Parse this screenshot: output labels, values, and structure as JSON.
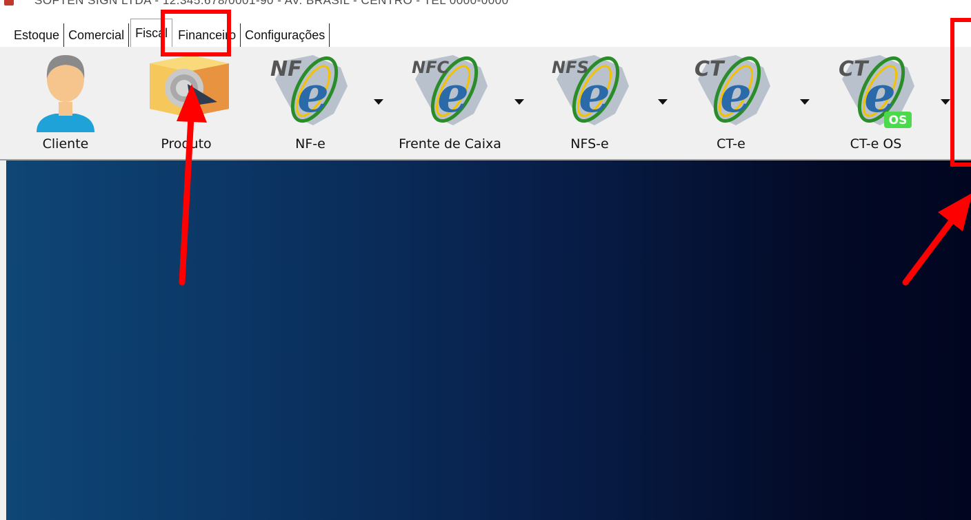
{
  "window": {
    "title": "SOFTEN SIGN LTDA - 12.345.678/0001-90 - AV. BRASIL - CENTRO - TEL 0000-0000"
  },
  "tabs": [
    {
      "label": "Estoque"
    },
    {
      "label": "Comercial"
    },
    {
      "label": "Fiscal",
      "active": true
    },
    {
      "label": "Financeiro"
    },
    {
      "label": "Configurações"
    }
  ],
  "toolbar": {
    "items": [
      {
        "label": "Cliente",
        "icon": "user-icon"
      },
      {
        "label": "Produto",
        "icon": "product-box-icon"
      },
      {
        "label": "NF-e",
        "icon": "nfe-icon",
        "badge": "NF",
        "has_dropdown": true
      },
      {
        "label": "Frente de Caixa",
        "icon": "nfce-icon",
        "badge": "NFC",
        "has_dropdown": true
      },
      {
        "label": "NFS-e",
        "icon": "nfse-icon",
        "badge": "NFS",
        "has_dropdown": true
      },
      {
        "label": "CT-e",
        "icon": "cte-icon",
        "badge": "CT",
        "has_dropdown": true
      },
      {
        "label": "CT-e OS",
        "icon": "cte-os-icon",
        "badge": "CT",
        "sub_badge": "OS",
        "has_dropdown": true
      }
    ]
  },
  "colors": {
    "highlight": "#ff0000",
    "toolbar_bg": "#f0f0f0",
    "main_gradient_start": "#0e4676",
    "main_gradient_end": "#010520",
    "nfe_green": "#2a8d2a",
    "nfe_blue": "#2b6aa8",
    "nfe_yellow": "#f2c200"
  }
}
